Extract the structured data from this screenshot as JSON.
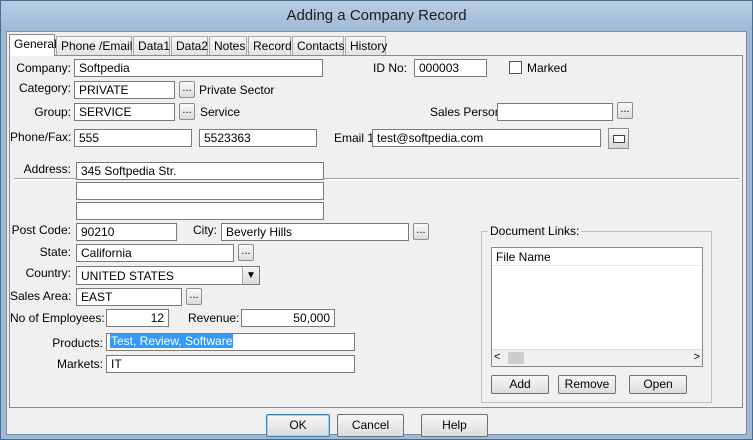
{
  "window": {
    "title": "Adding a Company  Record"
  },
  "tabs": [
    "General",
    "Phone /Email",
    "Data1",
    "Data2",
    "Notes",
    "Record",
    "Contacts",
    "History"
  ],
  "general": {
    "company_label": "Company:",
    "company_value": "Softpedia",
    "id_label": "ID No:",
    "id_value": "000003",
    "marked_label": "Marked",
    "category_label": "Category:",
    "category_value": "PRIVATE",
    "category_desc": "Private Sector",
    "group_label": "Group:",
    "group_value": "SERVICE",
    "group_desc": "Service",
    "sales_person_label": "Sales Person:",
    "sales_person_value": "",
    "phone_label": "Phone/Fax:",
    "phone_value": "555",
    "fax_value": "5523363",
    "email_label": "Email 1:",
    "email_value": "test@softpedia.com",
    "address_label": "Address:",
    "address_lines": [
      "345 Softpedia Str.",
      "",
      ""
    ],
    "postcode_label": "Post Code:",
    "postcode_value": "90210",
    "city_label": "City:",
    "city_value": "Beverly Hills",
    "state_label": "State:",
    "state_value": "California",
    "country_label": "Country:",
    "country_value": "UNITED STATES",
    "sales_area_label": "Sales Area:",
    "sales_area_value": "EAST",
    "employees_label": "No of Employees:",
    "employees_value": "12",
    "revenue_label": "Revenue:",
    "revenue_value": "50,000",
    "products_label": "Products:",
    "products_value": "Test, Review, Software",
    "markets_label": "Markets:",
    "markets_value": "IT",
    "doc_links_label": "Document Links:",
    "doc_list_header": "File Name",
    "add_label": "Add",
    "remove_label": "Remove",
    "open_label": "Open",
    "dots": "..."
  },
  "footer": {
    "ok_label": "OK",
    "cancel_label": "Cancel",
    "help_label": "Help"
  },
  "icons": {
    "browse": "ellipsis-button",
    "email": "envelope-icon",
    "dropdown": "chevron-down-icon"
  }
}
